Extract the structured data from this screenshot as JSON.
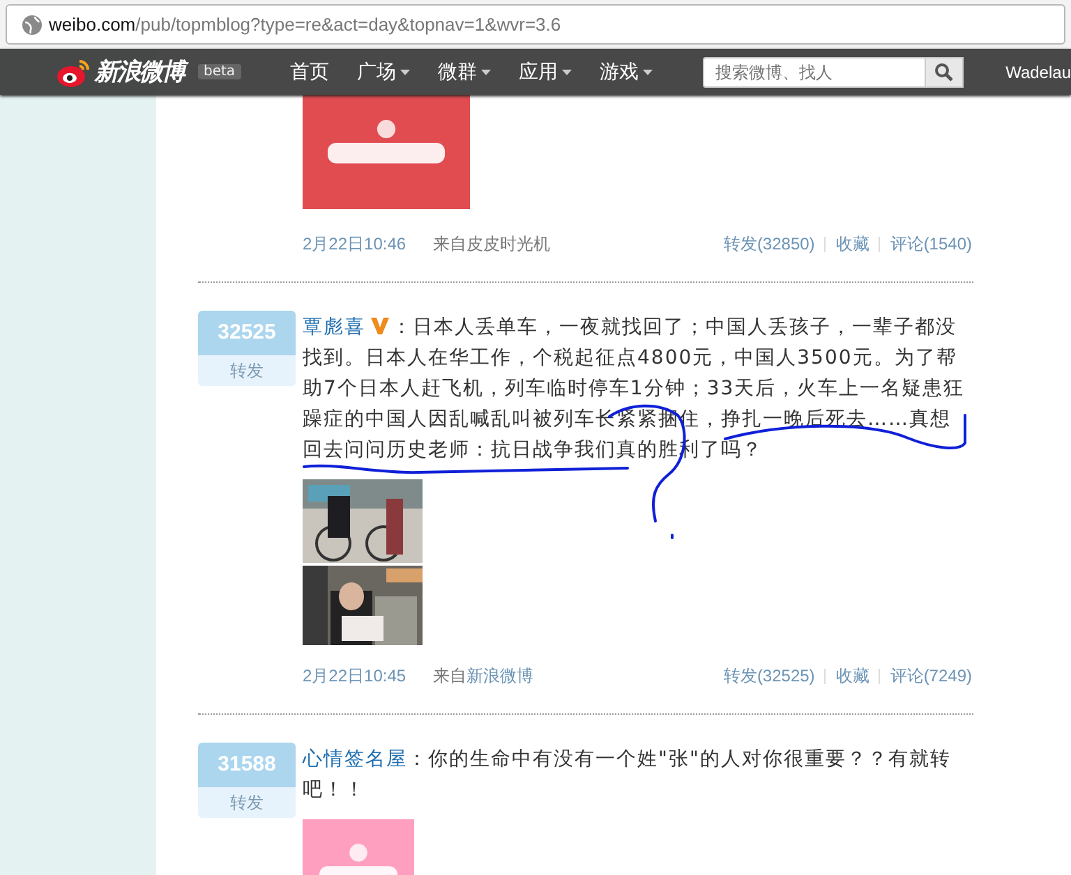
{
  "browser": {
    "url_host": "weibo.com",
    "url_path": "/pub/topmblog?type=re&act=day&topnav=1&wvr=3.6"
  },
  "nav": {
    "logo": "新浪微博",
    "badge": "beta",
    "items": [
      {
        "label": "首页",
        "dropdown": false
      },
      {
        "label": "广场",
        "dropdown": true
      },
      {
        "label": "微群",
        "dropdown": true
      },
      {
        "label": "应用",
        "dropdown": true
      },
      {
        "label": "游戏",
        "dropdown": true
      }
    ],
    "search": {
      "placeholder": "搜索微博、找人"
    },
    "user": "Wadelau"
  },
  "posts": [
    {
      "footer": {
        "time": "2月22日10:46",
        "source_prefix": "来自",
        "source": "皮皮时光机",
        "source_link": false,
        "actions": [
          "转发(32850)",
          "收藏",
          "评论(1540)"
        ]
      }
    },
    {
      "count": "32525",
      "repost_label": "转发",
      "author": "覃彪喜",
      "verified": true,
      "colon": "：",
      "text": "日本人丢单车，一夜就找回了；中国人丢孩子，一辈子都没找到。日本人在华工作，个税起征点4800元，中国人3500元。为了帮助7个日本人赶飞机，列车临时停车1分钟；33天后，火车上一名疑患狂躁症的中国人因乱喊乱叫被列车长紧紧捆住，挣扎一晚后死去……真想回去问问历史老师：抗日战争我们真的胜利了吗？",
      "footer": {
        "time": "2月22日10:45",
        "source_prefix": "来自",
        "source": "新浪微博",
        "source_link": true,
        "actions": [
          "转发(32525)",
          "收藏",
          "评论(7249)"
        ]
      }
    },
    {
      "count": "31588",
      "repost_label": "转发",
      "author": "心情签名屋",
      "verified": false,
      "colon": "：",
      "text": "你的生命中有没有一个姓\"张\"的人对你很重要？？有就转吧！！"
    }
  ]
}
